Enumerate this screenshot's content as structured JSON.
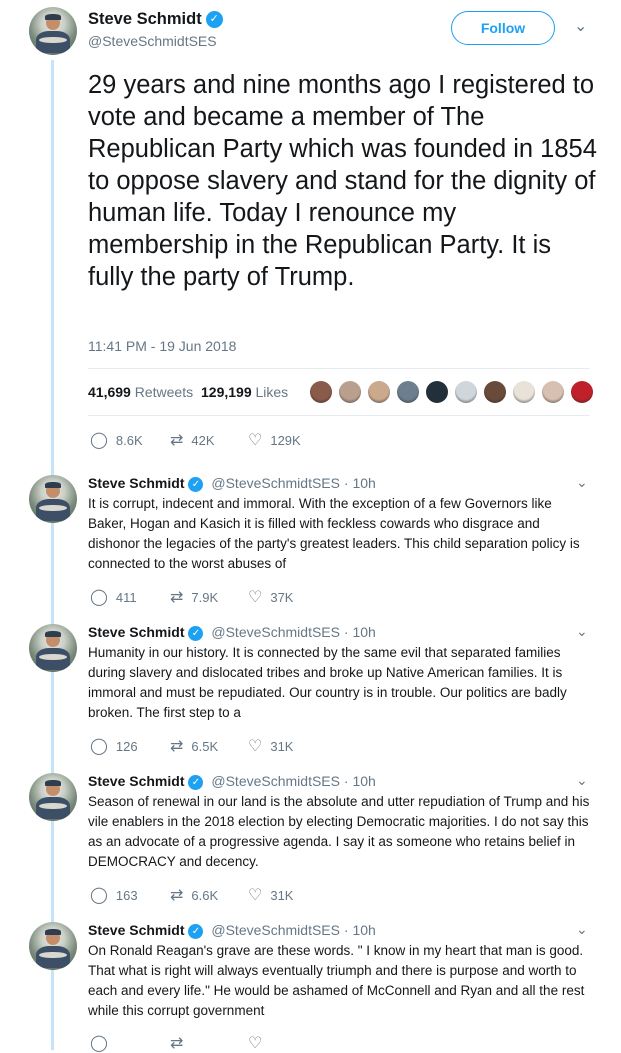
{
  "main": {
    "name": "Steve Schmidt",
    "handle": "@SteveSchmidtSES",
    "follow_label": "Follow",
    "text": "29 years and nine months ago I registered to vote and became a member of The Republican Party which was founded in 1854 to oppose slavery and stand for the dignity of human life. Today I renounce my membership in the Republican Party. It is fully the party of Trump.",
    "timestamp": "11:41 PM - 19 Jun 2018",
    "retweets_count": "41,699",
    "retweets_label": "Retweets",
    "likes_count": "129,199",
    "likes_label": "Likes",
    "replies": "8.6K",
    "retweets_short": "42K",
    "likes_short": "129K"
  },
  "tweets": [
    {
      "name": "Steve Schmidt",
      "handle": "@SteveSchmidtSES",
      "time": "10h",
      "text": "It is corrupt, indecent and immoral. With the exception of a few Governors like Baker, Hogan and Kasich it is filled with feckless cowards who disgrace and dishonor the legacies of the party's greatest leaders. This child separation policy is connected to the worst abuses of",
      "replies": "411",
      "retweets": "7.9K",
      "likes": "37K"
    },
    {
      "name": "Steve Schmidt",
      "handle": "@SteveSchmidtSES",
      "time": "10h",
      "text": "Humanity in our history. It is connected by the same evil that separated families during slavery and dislocated tribes and broke up Native American families. It is immoral and must be repudiated. Our country is in trouble. Our politics are badly broken.  The first step to a",
      "replies": "126",
      "retweets": "6.5K",
      "likes": "31K"
    },
    {
      "name": "Steve Schmidt",
      "handle": "@SteveSchmidtSES",
      "time": "10h",
      "text": "Season of renewal in our land is the absolute and utter repudiation of Trump and his vile enablers in the 2018 election by electing Democratic majorities. I do not say this as an advocate of a progressive agenda.  I say it as someone who retains belief in DEMOCRACY and decency.",
      "replies": "163",
      "retweets": "6.6K",
      "likes": "31K"
    },
    {
      "name": "Steve Schmidt",
      "handle": "@SteveSchmidtSES",
      "time": "10h",
      "text": "On Ronald Reagan's grave are these words. \" I know in my heart that man is good.  That what is right will always eventually triumph and there is purpose and worth to each and every life.\"  He would be ashamed of McConnell and Ryan and all the rest while this corrupt government",
      "replies": "",
      "retweets": "",
      "likes": ""
    }
  ],
  "icons": {
    "verified": "✓",
    "caret": "⌄",
    "reply": "◯",
    "retweet": "⇄",
    "like": "♡"
  },
  "colors": {
    "accent": "#1da1f2",
    "thread_line": "#c4e4f7",
    "muted": "#657786"
  },
  "likers": [
    "#8a5a4a",
    "#b9a08e",
    "#caa98c",
    "#6b7f8f",
    "#22303c",
    "#cfd6dc",
    "#6a4a3a",
    "#e9e2d8",
    "#d8c0b0",
    "#c0202a"
  ]
}
